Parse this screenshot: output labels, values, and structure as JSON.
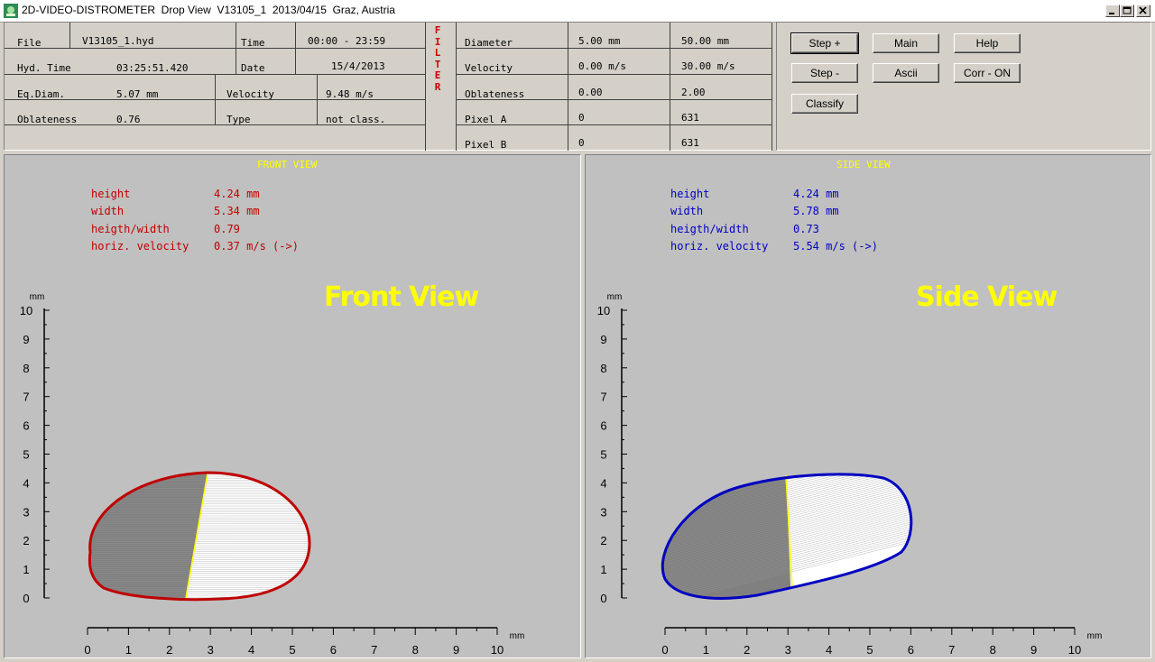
{
  "window": {
    "title": "2D-VIDEO-DISTROMETER  Drop View  V13105_1  2013/04/15  Graz, Austria"
  },
  "info": {
    "file_label": "File",
    "file_value": "V13105_1.hyd",
    "time_label": "Time",
    "time_value": "00:00 - 23:59",
    "hydtime_label": "Hyd. Time",
    "hydtime_value": "03:25:51.420",
    "date_label": "Date",
    "date_value": "15/4/2013",
    "eqdiam_label": "Eq.Diam.",
    "eqdiam_value": "5.07 mm",
    "velocity_label": "Velocity",
    "velocity_value": "9.48 m/s",
    "oblateness_label": "Oblateness",
    "oblateness_value": "0.76",
    "type_label": "Type",
    "type_value": "not class."
  },
  "filter": {
    "letters": [
      "F",
      "I",
      "L",
      "T",
      "E",
      "R"
    ],
    "rows": [
      {
        "label": "Diameter",
        "min": "5.00 mm",
        "max": "50.00 mm"
      },
      {
        "label": "Velocity",
        "min": "0.00 m/s",
        "max": "30.00 m/s"
      },
      {
        "label": "Oblateness",
        "min": "0.00",
        "max": "2.00"
      },
      {
        "label": "Pixel A",
        "min": "0",
        "max": "631"
      },
      {
        "label": "Pixel B",
        "min": "0",
        "max": "631"
      }
    ]
  },
  "buttons": {
    "step_plus": "Step +",
    "main": "Main",
    "help": "Help",
    "step_minus": "Step -",
    "ascii": "Ascii",
    "corr": "Corr - ON",
    "classify": "Classify"
  },
  "front": {
    "title": "FRONT VIEW",
    "label": "Front View",
    "color": "#c00000",
    "stats": [
      {
        "name": "height",
        "value": "4.24 mm"
      },
      {
        "name": "width",
        "value": "5.34 mm"
      },
      {
        "name": "heigth/width",
        "value": "0.79"
      },
      {
        "name": "horiz. velocity",
        "value": "0.37 m/s (->)"
      }
    ]
  },
  "side": {
    "title": "SIDE VIEW",
    "label": "Side View",
    "color": "#0000c0",
    "stats": [
      {
        "name": "height",
        "value": "4.24 mm"
      },
      {
        "name": "width",
        "value": "5.78 mm"
      },
      {
        "name": "heigth/width",
        "value": "0.73"
      },
      {
        "name": "horiz. velocity",
        "value": "5.54 m/s (->)"
      }
    ]
  },
  "axes": {
    "unit": "mm",
    "y_ticks": [
      "10",
      "9",
      "8",
      "7",
      "6",
      "5",
      "4",
      "3",
      "2",
      "1",
      "0"
    ],
    "x_ticks": [
      "0",
      "1",
      "2",
      "3",
      "4",
      "5",
      "6",
      "7",
      "8",
      "9",
      "10"
    ]
  }
}
